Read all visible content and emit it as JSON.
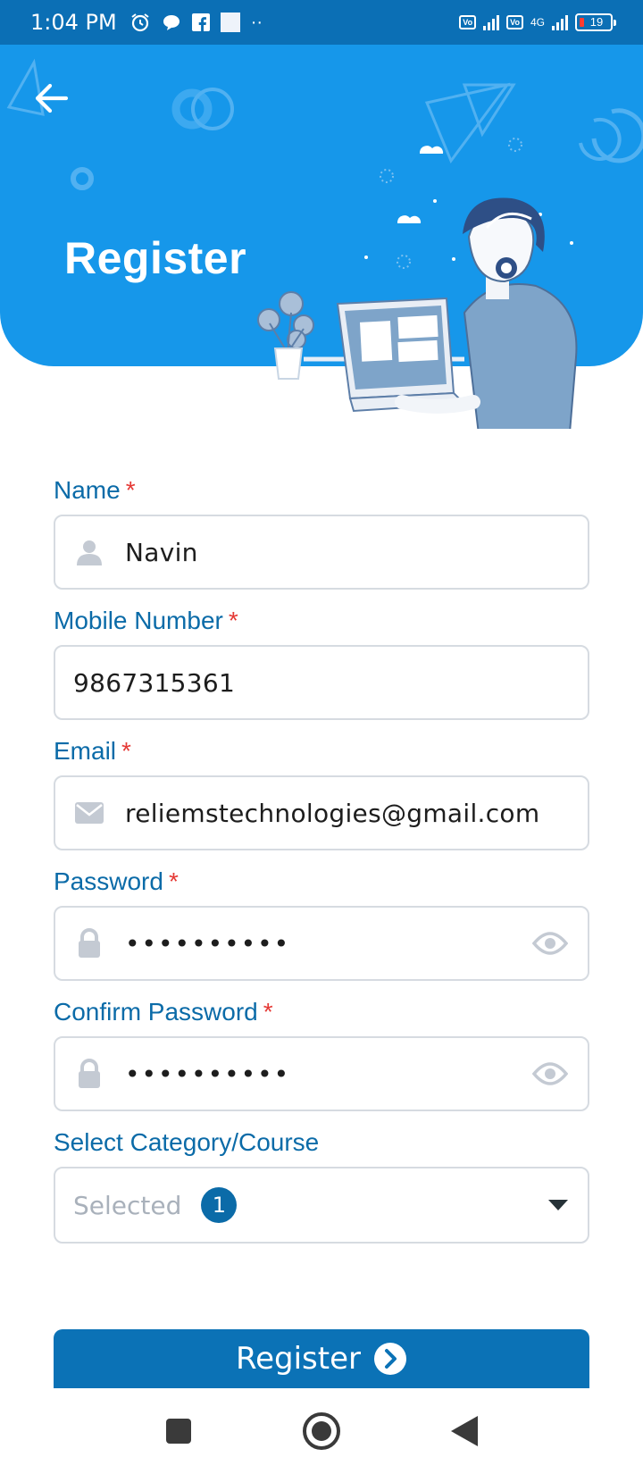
{
  "status_bar": {
    "time": "1:04 PM",
    "network": "4G",
    "battery": "19"
  },
  "header": {
    "title": "Register",
    "back_icon": "arrow-left-icon"
  },
  "form": {
    "name": {
      "label": "Name",
      "required": "*",
      "value": "Navin",
      "icon": "person-icon"
    },
    "mobile": {
      "label": "Mobile Number",
      "required": "*",
      "value": "9867315361"
    },
    "email": {
      "label": "Email",
      "required": "*",
      "value": "reliemstechnologies@gmail.com",
      "icon": "mail-icon"
    },
    "password": {
      "label": "Password",
      "required": "*",
      "masked": "••••••••••",
      "icon": "lock-icon"
    },
    "confirm_password": {
      "label": "Confirm Password",
      "required": "*",
      "masked": "••••••••••",
      "icon": "lock-icon"
    },
    "category": {
      "label": "Select Category/Course",
      "placeholder": "Selected",
      "count": "1"
    }
  },
  "actions": {
    "register_label": "Register"
  },
  "colors": {
    "primary": "#1697ea",
    "primary_dark": "#0b6ba8",
    "button": "#0b72b6",
    "required": "#e53935",
    "border": "#d6dbe1"
  }
}
